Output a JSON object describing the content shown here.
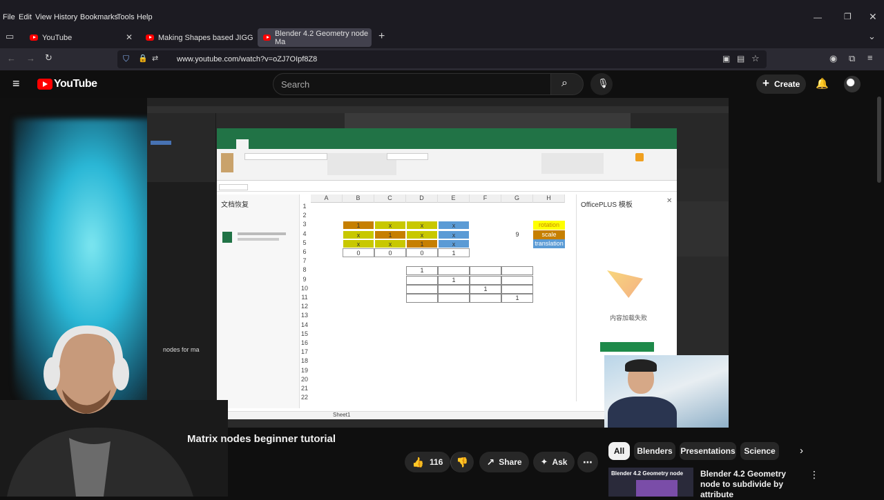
{
  "browser": {
    "menu": [
      "File",
      "Edit",
      "View",
      "History",
      "Bookmarks",
      "Tools",
      "Help"
    ],
    "tabs": [
      {
        "title": "YouTube"
      },
      {
        "title": "Making Shapes based JIGG"
      },
      {
        "title": "Blender 4.2 Geometry node Ma"
      }
    ],
    "url": "www.youtube.com/watch?v=oZJ7OIpf8Z8"
  },
  "youtube": {
    "logo": "YouTube",
    "search_placeholder": "Search",
    "create_label": "Create"
  },
  "video": {
    "title": "Matrix nodes beginner tutorial",
    "title_prefix": "·",
    "like_count": "116",
    "share_label": "Share",
    "ask_label": "Ask"
  },
  "excel": {
    "pane_title": "OfficePLUS 模板",
    "recover_title": "文档恢复",
    "columns": [
      "A",
      "B",
      "C",
      "D",
      "E",
      "F",
      "G",
      "H"
    ],
    "rows": [
      "1",
      "2",
      "3",
      "4",
      "5",
      "6",
      "7",
      "8",
      "9",
      "10",
      "11",
      "12",
      "13",
      "14",
      "15",
      "16",
      "17",
      "18",
      "19",
      "20",
      "21",
      "22"
    ],
    "matrix_x": "x",
    "matrix_one": "1",
    "row6": [
      "0",
      "0",
      "0",
      "1"
    ],
    "g4": "9",
    "legend": [
      "rotation",
      "scale",
      "translation"
    ],
    "identity": [
      "1",
      "1",
      "1",
      "1"
    ],
    "pane_msg": "内容加载失败",
    "sheet_tab": "Sheet1"
  },
  "chips": [
    "All",
    "Blenders",
    "Presentations",
    "Science"
  ],
  "recommendation": {
    "thumb_text": "Blender 4.2 Geometry node",
    "title": "Blender 4.2 Geometry node to subdivide by attribute"
  },
  "colors": {
    "accent_red": "#ff0000",
    "excel_green": "#217346",
    "cell_orange": "#c67f00",
    "cell_yellow": "#c8c800",
    "cell_blue": "#5b9bd5"
  }
}
